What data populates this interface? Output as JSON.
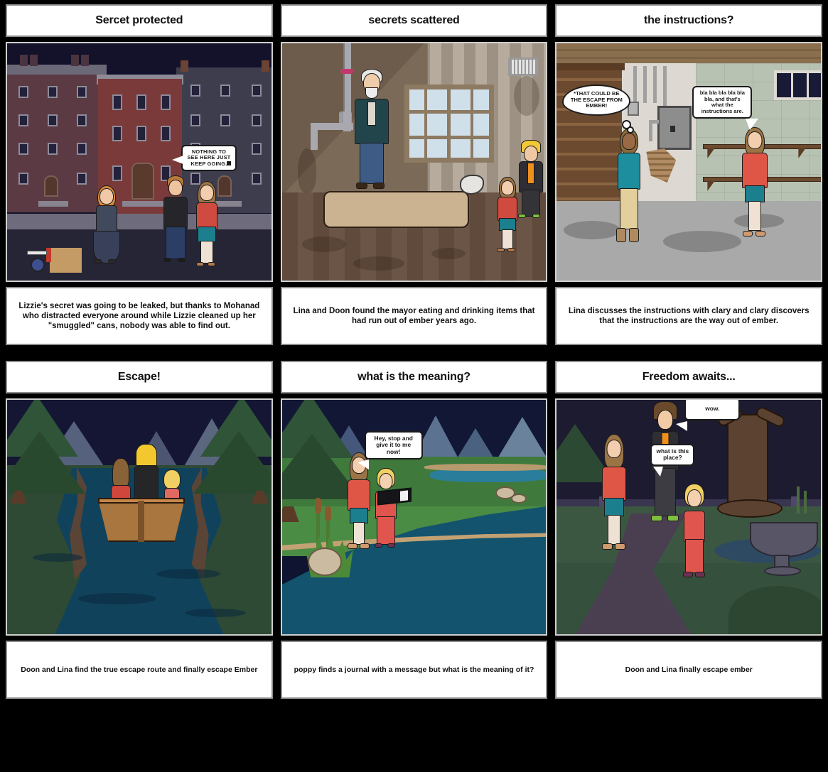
{
  "storyboard": {
    "background_color": "#000000",
    "cell_background": "#ffffff",
    "cell_border": "#8d8d8d",
    "rows": 2,
    "columns": 3
  },
  "panels": [
    {
      "id": "panel-1",
      "title": "Sercet protected",
      "caption": "Lizzie's secret was going to be leaked, but thanks to Mohanad who distracted everyone around while Lizzie cleaned up her \"smuggled\" cans, nobody was able to find out.",
      "scene": "night-street-row-houses",
      "bubbles": [
        {
          "type": "speech",
          "text": "NOTHING TO SEE HERE JUST KEEP GOING."
        }
      ]
    },
    {
      "id": "panel-2",
      "title": "secrets scattered",
      "caption": "Lina and Doon found the mayor eating and drinking items that had run out of ember years ago.",
      "scene": "derelict-room-mattress",
      "bubbles": []
    },
    {
      "id": "panel-3",
      "title": "the instructions?",
      "caption": "Lina discusses the instructions with clary and clary discovers that the instructions are the way out of ember.",
      "scene": "basement-stairs-breaker-box",
      "bubbles": [
        {
          "type": "thought",
          "text": "*THAT COULD BE THE ESCAPE FROM EMBER!"
        },
        {
          "type": "speech",
          "text": "bla bla bla bla bla bla, and that's what the instructions are."
        }
      ]
    },
    {
      "id": "panel-4",
      "title": "Escape!",
      "caption": "Doon and Lina find the true escape route and finally escape Ember",
      "scene": "night-river-boat-mountains",
      "bubbles": []
    },
    {
      "id": "panel-5",
      "title": "what is the meaning?",
      "caption": "poppy finds a journal with a message but what is the meaning of it?",
      "scene": "riverbank-night-mountains",
      "bubbles": [
        {
          "type": "speech",
          "text": "Hey, stop and give it to me now!"
        }
      ]
    },
    {
      "id": "panel-6",
      "title": "Freedom awaits...",
      "caption": "Doon and Lina finally escape ember",
      "scene": "night-park-fountain-tree",
      "bubbles": [
        {
          "type": "speech",
          "text": "wow."
        },
        {
          "type": "speech",
          "text": "what is this place?"
        }
      ]
    }
  ]
}
